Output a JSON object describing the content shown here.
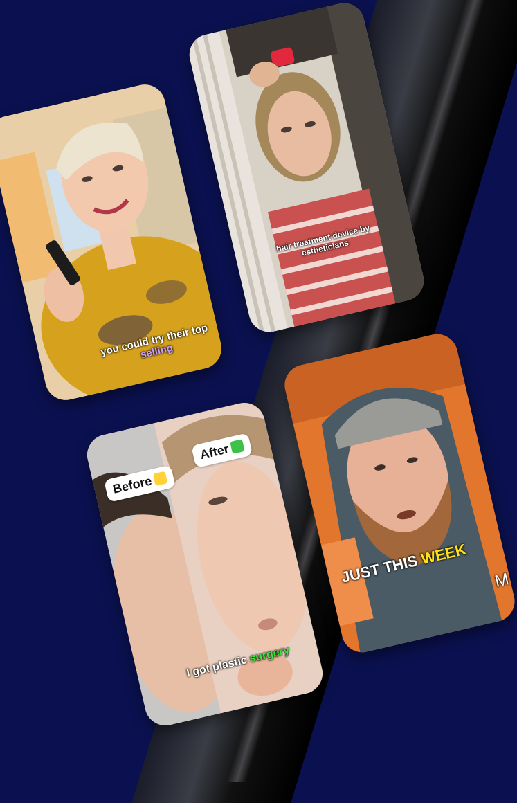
{
  "cards": [
    {
      "caption_line1": "you could try their top",
      "caption_line2": "selling"
    },
    {
      "caption_line1": "hair treatment device by",
      "caption_line2": "estheticians"
    },
    {
      "badge_before": "Before",
      "badge_after": "After",
      "caption_prefix": "I got plastic ",
      "caption_highlight": "surgery"
    },
    {
      "caption_prefix": "JUST THIS ",
      "caption_highlight": "WEEK",
      "side_letter": "M"
    }
  ]
}
